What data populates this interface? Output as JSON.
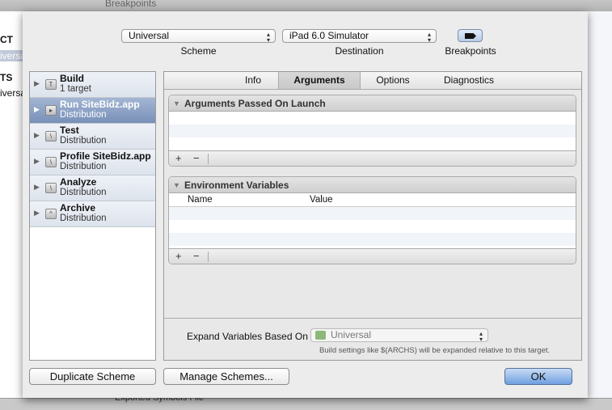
{
  "background": {
    "title": "Breakpoints",
    "sidebar": [
      "CT",
      "iversa",
      "TS",
      "iversa"
    ],
    "bottom_text": "Exported Symbols File"
  },
  "toolbar": {
    "scheme": {
      "value": "Universal",
      "label": "Scheme"
    },
    "destination": {
      "value": "iPad 6.0 Simulator",
      "label": "Destination"
    },
    "breakpoints": {
      "label": "Breakpoints"
    }
  },
  "actions": [
    {
      "title": "Build",
      "subtitle": "1 target",
      "icon": "hammer-icon"
    },
    {
      "title": "Run SiteBidz.app",
      "subtitle": "Distribution",
      "icon": "play-icon",
      "selected": true
    },
    {
      "title": "Test",
      "subtitle": "Distribution",
      "icon": "wrench-icon"
    },
    {
      "title": "Profile SiteBidz.app",
      "subtitle": "Distribution",
      "icon": "wrench-icon"
    },
    {
      "title": "Analyze",
      "subtitle": "Distribution",
      "icon": "wrench-icon"
    },
    {
      "title": "Archive",
      "subtitle": "Distribution",
      "icon": "archive-icon"
    }
  ],
  "tabs": [
    {
      "label": "Info"
    },
    {
      "label": "Arguments",
      "selected": true
    },
    {
      "label": "Options"
    },
    {
      "label": "Diagnostics"
    }
  ],
  "arguments": {
    "title": "Arguments Passed On Launch",
    "add": "+",
    "remove": "−"
  },
  "environment": {
    "title": "Environment Variables",
    "columns": [
      "Name",
      "Value"
    ],
    "add": "+",
    "remove": "−"
  },
  "expand": {
    "label": "Expand Variables Based On",
    "value": "Universal",
    "hint": "Build settings like $(ARCHS) will be expanded relative to this target."
  },
  "buttons": {
    "duplicate": "Duplicate Scheme",
    "manage": "Manage Schemes...",
    "ok": "OK"
  }
}
